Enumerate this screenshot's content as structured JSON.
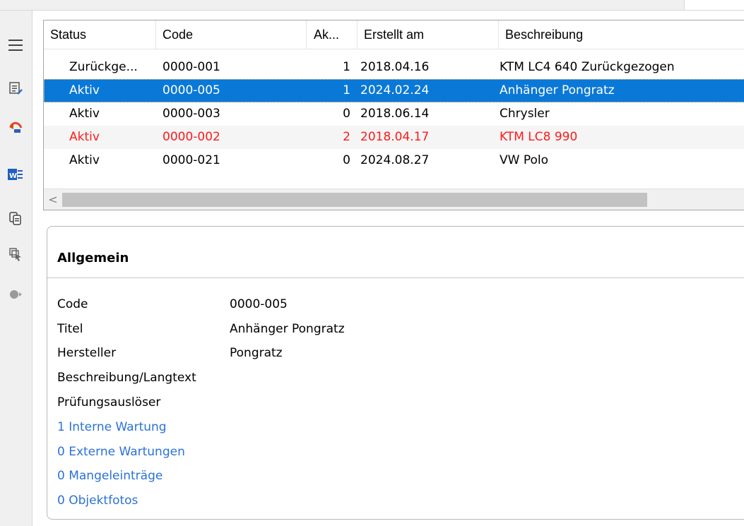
{
  "toolbar": {
    "icons": [
      "hamburger-menu-icon",
      "edit-list-icon",
      "undo-arrow-icon",
      "word-document-icon",
      "copy-documents-icon",
      "select-pointer-icon",
      "forward-circle-icon"
    ]
  },
  "table": {
    "columns": [
      "Status",
      "Code",
      "Ak...",
      "Erstellt am",
      "Beschreibung"
    ],
    "rows": [
      {
        "status": "Zurückge...",
        "code": "0000-001",
        "ak": "1",
        "erstellt": "2018.04.16",
        "beschreibung": "KTM LC4 640 Zurückgezogen"
      },
      {
        "status": "Aktiv",
        "code": "0000-005",
        "ak": "1",
        "erstellt": "2024.02.24",
        "beschreibung": "Anhänger Pongratz"
      },
      {
        "status": "Aktiv",
        "code": "0000-003",
        "ak": "0",
        "erstellt": "2018.06.14",
        "beschreibung": "Chrysler"
      },
      {
        "status": "Aktiv",
        "code": "0000-002",
        "ak": "2",
        "erstellt": "2018.04.17",
        "beschreibung": "KTM LC8 990"
      },
      {
        "status": "Aktiv",
        "code": "0000-021",
        "ak": "0",
        "erstellt": "2024.08.27",
        "beschreibung": "VW Polo"
      }
    ],
    "scroll_left_glyph": "<"
  },
  "detail": {
    "title": "Allgemein",
    "fields": [
      {
        "label": "Code",
        "value": "0000-005"
      },
      {
        "label": "Titel",
        "value": "Anhänger Pongratz"
      },
      {
        "label": "Hersteller",
        "value": "Pongratz"
      },
      {
        "label": "Beschreibung/Langtext",
        "value": ""
      },
      {
        "label": "Prüfungsauslöser",
        "value": ""
      }
    ],
    "links": [
      "1 Interne Wartung",
      "0 Externe Wartungen",
      "0 Mangeleinträge",
      "0 Objektfotos"
    ]
  },
  "colors": {
    "selection": "#0a78d7",
    "warning_row": "#ff1a1a",
    "link": "#2b72d6"
  }
}
